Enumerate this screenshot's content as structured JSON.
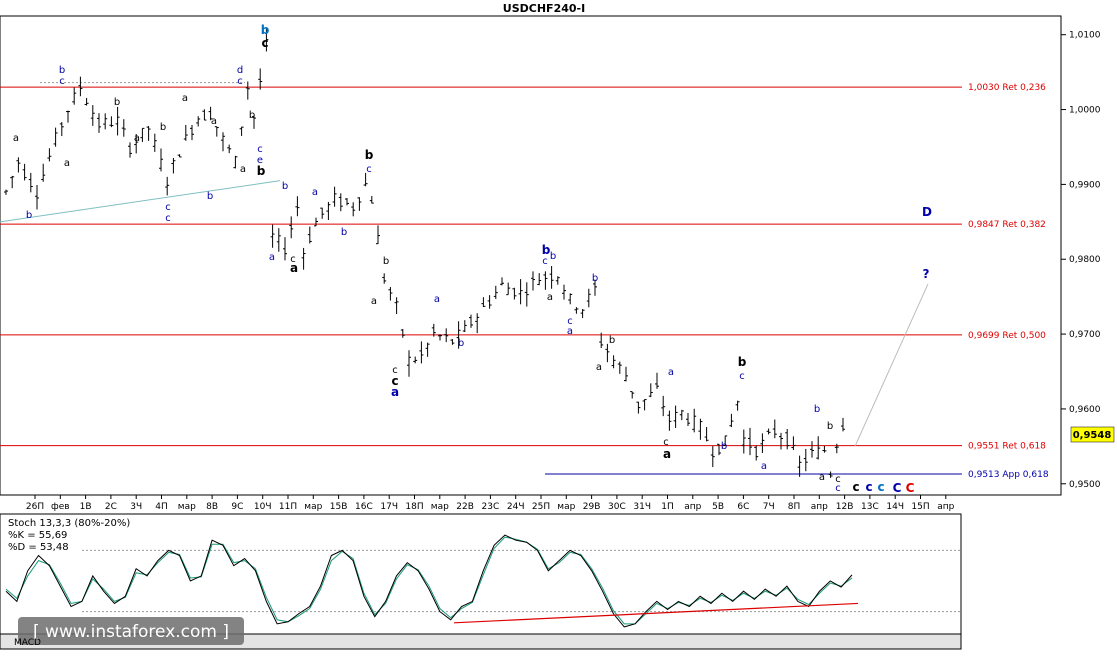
{
  "title": "USDCHF240-I",
  "colors": {
    "price": "#000000",
    "fibo": "#dd0000",
    "app": "#0000aa",
    "trend": "#7fbfbf",
    "projection": "#bbbbbb",
    "k_line": "#000000",
    "d_line": "#1a9a7a",
    "support": "#dd0000",
    "price_tag": "#ffff00",
    "grid": "#999999"
  },
  "chart_data": {
    "type": "ohlc",
    "title": "USDCHF240-I",
    "ylim": [
      0.9485,
      1.0125
    ],
    "y_ticks": [
      "1,0100",
      "1,0000",
      "0,9900",
      "0,9800",
      "0,9700",
      "0,9600",
      "0,9500"
    ],
    "x_ticks": [
      "26П",
      "фев",
      "1В",
      "2С",
      "3Ч",
      "4П",
      "мар",
      "8В",
      "9С",
      "10Ч",
      "11П",
      "мар",
      "15В",
      "16С",
      "17Ч",
      "18П",
      "мар",
      "22В",
      "23С",
      "24Ч",
      "25П",
      "мар",
      "29В",
      "30С",
      "31Ч",
      "1П",
      "апр",
      "5В",
      "6С",
      "7Ч",
      "8П",
      "апр",
      "12В",
      "13С",
      "14Ч",
      "15П",
      "апр"
    ],
    "current_price": "0,9548",
    "levels": [
      {
        "price": 1.003,
        "label": "1,0030 Ret 0,236",
        "kind": "fibo"
      },
      {
        "price": 0.9847,
        "label": "0,9847 Ret 0,382",
        "kind": "fibo"
      },
      {
        "price": 0.9699,
        "label": "0,9699 Ret 0,500",
        "kind": "fibo"
      },
      {
        "price": 0.9551,
        "label": "0,9551 Ret 0,618",
        "kind": "fibo"
      },
      {
        "price": 0.9513,
        "label": "0,9513 App 0,618",
        "kind": "app"
      }
    ],
    "price_path": [
      [
        0,
        0.989
      ],
      [
        2,
        0.993
      ],
      [
        5,
        0.989
      ],
      [
        8,
        0.996
      ],
      [
        10,
        1.0
      ],
      [
        12,
        1.003
      ],
      [
        15,
        0.998
      ],
      [
        18,
        0.9985
      ],
      [
        20,
        0.995
      ],
      [
        23,
        0.9975
      ],
      [
        26,
        0.9905
      ],
      [
        28,
        0.9945
      ],
      [
        31,
        0.999
      ],
      [
        33,
        0.9995
      ],
      [
        35,
        0.996
      ],
      [
        37,
        0.993
      ],
      [
        39,
        1.003
      ],
      [
        40,
        0.999
      ],
      [
        42,
        1.0085
      ],
      [
        43,
        0.983
      ],
      [
        45,
        0.9815
      ],
      [
        47,
        0.987
      ],
      [
        48,
        0.981
      ],
      [
        50,
        0.985
      ],
      [
        53,
        0.988
      ],
      [
        56,
        0.987
      ],
      [
        58,
        0.99
      ],
      [
        59,
        0.988
      ],
      [
        61,
        0.9775
      ],
      [
        63,
        0.9735
      ],
      [
        65,
        0.9665
      ],
      [
        67,
        0.967
      ],
      [
        69,
        0.97
      ],
      [
        72,
        0.969
      ],
      [
        74,
        0.9705
      ],
      [
        77,
        0.9735
      ],
      [
        80,
        0.9765
      ],
      [
        83,
        0.9755
      ],
      [
        86,
        0.9775
      ],
      [
        89,
        0.978
      ],
      [
        91,
        0.9745
      ],
      [
        93,
        0.9735
      ],
      [
        95,
        0.976
      ],
      [
        96,
        0.969
      ],
      [
        98,
        0.9665
      ],
      [
        100,
        0.9645
      ],
      [
        102,
        0.9605
      ],
      [
        105,
        0.9625
      ],
      [
        107,
        0.9585
      ],
      [
        109,
        0.9595
      ],
      [
        112,
        0.9575
      ],
      [
        114,
        0.9545
      ],
      [
        116,
        0.9555
      ],
      [
        118,
        0.961
      ],
      [
        119,
        0.956
      ],
      [
        121,
        0.9545
      ],
      [
        124,
        0.957
      ],
      [
        126,
        0.956
      ],
      [
        128,
        0.9525
      ],
      [
        130,
        0.954
      ],
      [
        132,
        0.9545
      ],
      [
        133,
        0.9515
      ],
      [
        134,
        0.9555
      ],
      [
        135,
        0.958
      ],
      [
        136,
        0.9548
      ]
    ],
    "projection_end": "?",
    "stochastic": {
      "name": "Stoch 13,3,3 (80%-20%)",
      "k_label": "%K = 55,69",
      "d_label": "%D = 53,48",
      "upper": 80,
      "lower": 20,
      "k_values": [
        40,
        30,
        60,
        75,
        65,
        45,
        25,
        30,
        55,
        40,
        28,
        35,
        62,
        55,
        70,
        80,
        75,
        50,
        55,
        90,
        85,
        65,
        72,
        60,
        30,
        8,
        10,
        18,
        25,
        45,
        75,
        80,
        70,
        35,
        15,
        30,
        55,
        68,
        60,
        42,
        20,
        12,
        25,
        30,
        60,
        85,
        95,
        90,
        88,
        80,
        60,
        70,
        80,
        75,
        60,
        40,
        18,
        5,
        8,
        20,
        30,
        22,
        30,
        25,
        35,
        28,
        38,
        30,
        40,
        32,
        42,
        35,
        45,
        30,
        25,
        40,
        50,
        44,
        56
      ],
      "d_values": [
        42,
        33,
        55,
        70,
        66,
        48,
        28,
        30,
        52,
        42,
        30,
        34,
        58,
        56,
        68,
        78,
        76,
        53,
        54,
        86,
        86,
        68,
        70,
        62,
        34,
        12,
        10,
        16,
        23,
        42,
        70,
        79,
        72,
        38,
        17,
        28,
        52,
        66,
        61,
        45,
        23,
        14,
        23,
        29,
        56,
        82,
        93,
        91,
        88,
        81,
        62,
        68,
        78,
        76,
        62,
        43,
        21,
        8,
        8,
        18,
        28,
        23,
        29,
        26,
        33,
        29,
        36,
        31,
        38,
        33,
        40,
        36,
        43,
        32,
        27,
        38,
        48,
        45,
        53
      ],
      "support": [
        [
          90,
          9
        ],
        [
          106,
          28
        ]
      ]
    }
  },
  "wave_labels": [
    {
      "text": "b",
      "x": 62,
      "y": 73,
      "color": "#0000aa",
      "bold": false
    },
    {
      "text": "c",
      "x": 62,
      "y": 84,
      "color": "#0000aa",
      "bold": false
    },
    {
      "text": "b",
      "x": 29,
      "y": 218,
      "color": "#0000aa",
      "bold": false
    },
    {
      "text": "a",
      "x": 16,
      "y": 141,
      "color": "#000000",
      "bold": false
    },
    {
      "text": "a",
      "x": 67,
      "y": 166,
      "color": "#000000",
      "bold": false
    },
    {
      "text": "b",
      "x": 117,
      "y": 105,
      "color": "#000000",
      "bold": false
    },
    {
      "text": "a",
      "x": 137,
      "y": 141,
      "color": "#000000",
      "bold": false
    },
    {
      "text": "c",
      "x": 168,
      "y": 210,
      "color": "#0000aa",
      "bold": false
    },
    {
      "text": "c",
      "x": 168,
      "y": 221,
      "color": "#0000aa",
      "bold": false
    },
    {
      "text": "a",
      "x": 185,
      "y": 101,
      "color": "#000000",
      "bold": false
    },
    {
      "text": "b",
      "x": 163,
      "y": 130,
      "color": "#000000",
      "bold": false
    },
    {
      "text": "b",
      "x": 210,
      "y": 199,
      "color": "#0000aa",
      "bold": false
    },
    {
      "text": "a",
      "x": 214,
      "y": 124,
      "color": "#000000",
      "bold": false
    },
    {
      "text": "d",
      "x": 240,
      "y": 73,
      "color": "#0000aa",
      "bold": false
    },
    {
      "text": "c",
      "x": 240,
      "y": 84,
      "color": "#0000aa",
      "bold": false
    },
    {
      "text": "b",
      "x": 252,
      "y": 118,
      "color": "#000000",
      "bold": false
    },
    {
      "text": "a",
      "x": 243,
      "y": 172,
      "color": "#000000",
      "bold": false
    },
    {
      "text": "c",
      "x": 260,
      "y": 152,
      "color": "#0000aa",
      "bold": false
    },
    {
      "text": "e",
      "x": 260,
      "y": 163,
      "color": "#0000aa",
      "bold": false
    },
    {
      "text": "b",
      "x": 261,
      "y": 175,
      "color": "#000000",
      "bold": true
    },
    {
      "text": "b",
      "x": 265,
      "y": 34,
      "color": "#0070c0",
      "bold": true
    },
    {
      "text": "c",
      "x": 265,
      "y": 47,
      "color": "#000000",
      "bold": true
    },
    {
      "text": "b",
      "x": 285,
      "y": 189,
      "color": "#0000aa",
      "bold": false
    },
    {
      "text": "a",
      "x": 272,
      "y": 260,
      "color": "#0000aa",
      "bold": false
    },
    {
      "text": "c",
      "x": 293,
      "y": 262,
      "color": "#000000",
      "bold": false
    },
    {
      "text": "a",
      "x": 294,
      "y": 272,
      "color": "#000000",
      "bold": true
    },
    {
      "text": "a",
      "x": 315,
      "y": 195,
      "color": "#0000aa",
      "bold": false
    },
    {
      "text": "b",
      "x": 344,
      "y": 235,
      "color": "#0000aa",
      "bold": false
    },
    {
      "text": "b",
      "x": 369,
      "y": 159,
      "color": "#000000",
      "bold": true
    },
    {
      "text": "c",
      "x": 369,
      "y": 172,
      "color": "#0000aa",
      "bold": false
    },
    {
      "text": "b",
      "x": 386,
      "y": 264,
      "color": "#000000",
      "bold": false
    },
    {
      "text": "a",
      "x": 374,
      "y": 304,
      "color": "#000000",
      "bold": false
    },
    {
      "text": "c",
      "x": 395,
      "y": 373,
      "color": "#000000",
      "bold": false
    },
    {
      "text": "c",
      "x": 395,
      "y": 385,
      "color": "#000000",
      "bold": true
    },
    {
      "text": "a",
      "x": 395,
      "y": 396,
      "color": "#0000aa",
      "bold": true
    },
    {
      "text": "a",
      "x": 437,
      "y": 302,
      "color": "#0000aa",
      "bold": false
    },
    {
      "text": "b",
      "x": 461,
      "y": 346,
      "color": "#0000aa",
      "bold": false
    },
    {
      "text": "b",
      "x": 546,
      "y": 254,
      "color": "#0000aa",
      "bold": true
    },
    {
      "text": "b",
      "x": 553,
      "y": 259,
      "color": "#0000aa",
      "bold": false
    },
    {
      "text": "c",
      "x": 545,
      "y": 264,
      "color": "#0000aa",
      "bold": false
    },
    {
      "text": "a",
      "x": 550,
      "y": 300,
      "color": "#000000",
      "bold": false
    },
    {
      "text": "b",
      "x": 595,
      "y": 281,
      "color": "#0000aa",
      "bold": false
    },
    {
      "text": "c",
      "x": 570,
      "y": 324,
      "color": "#0000aa",
      "bold": false
    },
    {
      "text": "a",
      "x": 570,
      "y": 334,
      "color": "#0000aa",
      "bold": false
    },
    {
      "text": "b",
      "x": 612,
      "y": 343,
      "color": "#000000",
      "bold": false
    },
    {
      "text": "a",
      "x": 599,
      "y": 370,
      "color": "#000000",
      "bold": false
    },
    {
      "text": "a",
      "x": 671,
      "y": 375,
      "color": "#0000aa",
      "bold": false
    },
    {
      "text": "c",
      "x": 666,
      "y": 445,
      "color": "#000000",
      "bold": false
    },
    {
      "text": "a",
      "x": 667,
      "y": 458,
      "color": "#000000",
      "bold": true
    },
    {
      "text": "b",
      "x": 742,
      "y": 366,
      "color": "#000000",
      "bold": true
    },
    {
      "text": "c",
      "x": 742,
      "y": 379,
      "color": "#0000aa",
      "bold": false
    },
    {
      "text": "b",
      "x": 724,
      "y": 449,
      "color": "#0000aa",
      "bold": false
    },
    {
      "text": "a",
      "x": 764,
      "y": 469,
      "color": "#0000aa",
      "bold": false
    },
    {
      "text": "b",
      "x": 817,
      "y": 412,
      "color": "#0000aa",
      "bold": false
    },
    {
      "text": "b",
      "x": 830,
      "y": 429,
      "color": "#000000",
      "bold": false
    },
    {
      "text": "a",
      "x": 822,
      "y": 480,
      "color": "#000000",
      "bold": false
    },
    {
      "text": "c",
      "x": 838,
      "y": 482,
      "color": "#000000",
      "bold": false
    },
    {
      "text": "c",
      "x": 838,
      "y": 491,
      "color": "#0000aa",
      "bold": false
    },
    {
      "text": "c",
      "x": 856,
      "y": 491,
      "color": "#000000",
      "bold": true
    },
    {
      "text": "c",
      "x": 869,
      "y": 491,
      "color": "#0000aa",
      "bold": true
    },
    {
      "text": "c",
      "x": 881,
      "y": 491,
      "color": "#0070c0",
      "bold": true
    },
    {
      "text": "C",
      "x": 897,
      "y": 492,
      "color": "#0000aa",
      "bold": true
    },
    {
      "text": "C",
      "x": 910,
      "y": 492,
      "color": "#dd0000",
      "bold": true
    },
    {
      "text": "D",
      "x": 927,
      "y": 216,
      "color": "#0000aa",
      "bold": true
    },
    {
      "text": "?",
      "x": 926,
      "y": 278,
      "color": "#0000aa",
      "bold": true
    }
  ],
  "watermark": "[ www.instaforex.com ]",
  "bottom_indicator_label": "MACD"
}
